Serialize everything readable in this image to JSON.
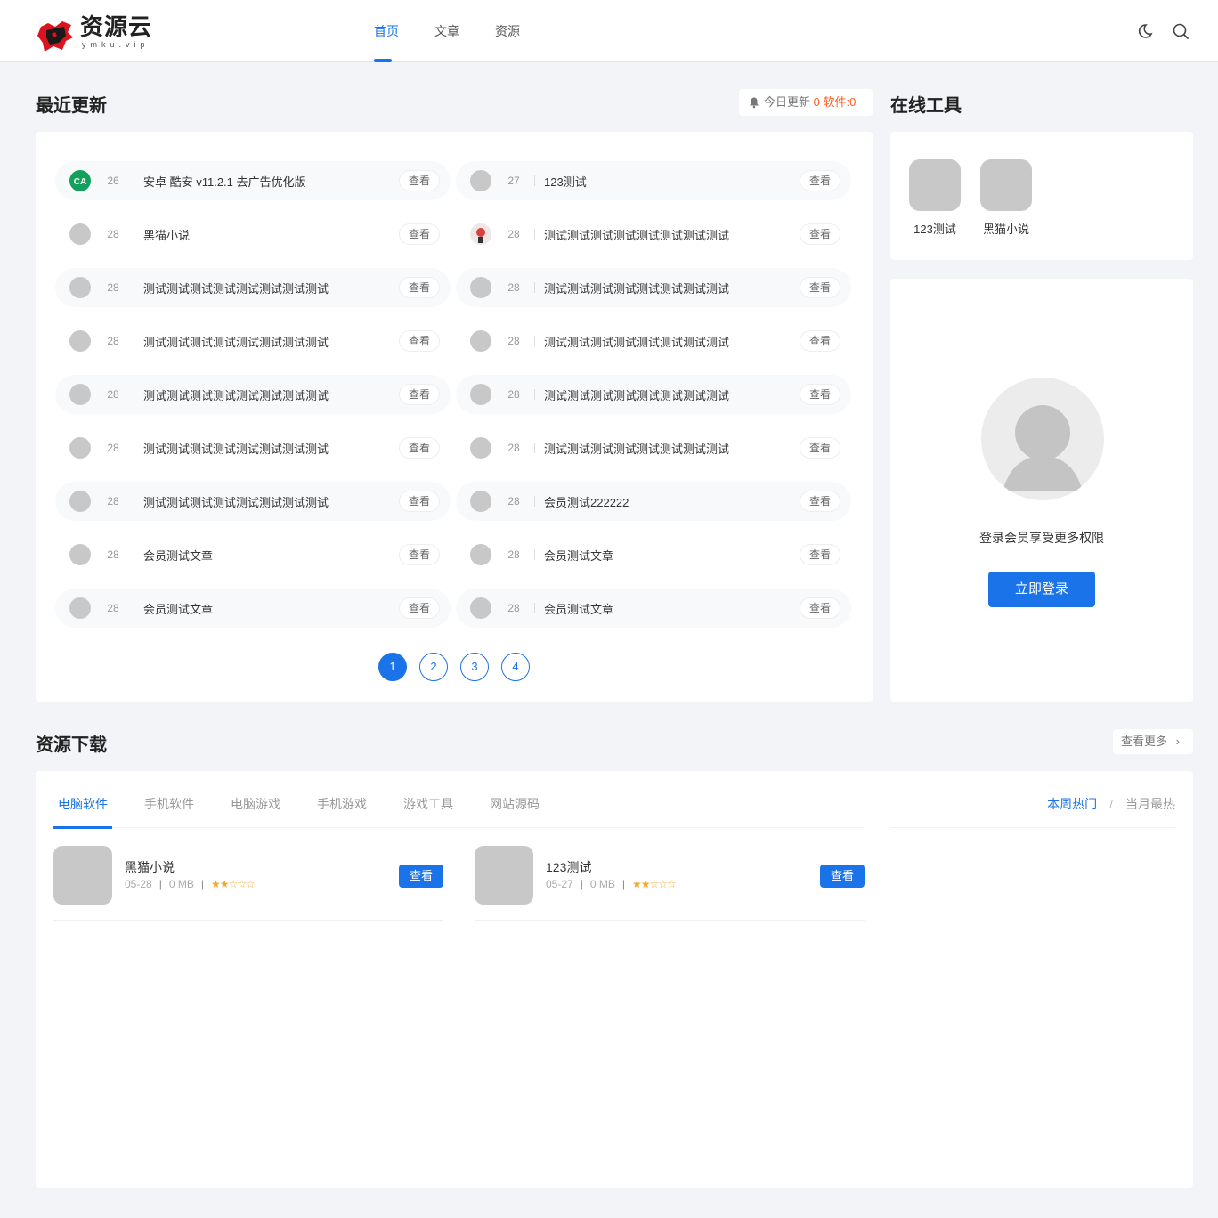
{
  "header": {
    "logo_title": "资源云",
    "logo_sub": "ymku.vip",
    "nav": [
      "首页",
      "文章",
      "资源"
    ]
  },
  "recent": {
    "title": "最近更新",
    "notice_prefix": "今日更新",
    "notice_count": "0",
    "notice_software": "软件:0",
    "view_label": "查看",
    "rows": [
      [
        {
          "num": "26",
          "title": "安卓 酷安 v11.2.1 去广告优化版"
        },
        {
          "num": "27",
          "title": "123测试"
        }
      ],
      [
        {
          "num": "28",
          "title": "黑猫小说"
        },
        {
          "num": "28",
          "title": "测试测试测试测试测试测试测试测试"
        }
      ],
      [
        {
          "num": "28",
          "title": "测试测试测试测试测试测试测试测试"
        },
        {
          "num": "28",
          "title": "测试测试测试测试测试测试测试测试"
        }
      ],
      [
        {
          "num": "28",
          "title": "测试测试测试测试测试测试测试测试"
        },
        {
          "num": "28",
          "title": "测试测试测试测试测试测试测试测试"
        }
      ],
      [
        {
          "num": "28",
          "title": "测试测试测试测试测试测试测试测试"
        },
        {
          "num": "28",
          "title": "测试测试测试测试测试测试测试测试"
        }
      ],
      [
        {
          "num": "28",
          "title": "测试测试测试测试测试测试测试测试"
        },
        {
          "num": "28",
          "title": "测试测试测试测试测试测试测试测试"
        }
      ],
      [
        {
          "num": "28",
          "title": "测试测试测试测试测试测试测试测试"
        },
        {
          "num": "28",
          "title": "会员测试222222"
        }
      ],
      [
        {
          "num": "28",
          "title": "会员测试文章"
        },
        {
          "num": "28",
          "title": "会员测试文章"
        }
      ],
      [
        {
          "num": "28",
          "title": "会员测试文章"
        },
        {
          "num": "28",
          "title": "会员测试文章"
        }
      ]
    ],
    "pages": [
      "1",
      "2",
      "3",
      "4"
    ]
  },
  "tools": {
    "title": "在线工具",
    "items": [
      "123测试",
      "黑猫小说"
    ]
  },
  "login": {
    "text": "登录会员享受更多权限",
    "button": "立即登录"
  },
  "downloads": {
    "title": "资源下载",
    "more": "查看更多",
    "tabs": [
      "电脑软件",
      "手机软件",
      "电脑游戏",
      "手机游戏",
      "游戏工具",
      "网站源码"
    ],
    "rank_tabs": [
      "本周热门",
      "当月最热"
    ],
    "items": [
      {
        "name": "黑猫小说",
        "date": "05-28",
        "size": "0 MB",
        "stars": "★★☆☆☆",
        "button": "查看"
      },
      {
        "name": "123测试",
        "date": "05-27",
        "size": "0 MB",
        "stars": "★★☆☆☆",
        "button": "查看"
      }
    ]
  },
  "colors": {
    "accent": "#1a73e8",
    "highlight": "#ff5a1f",
    "star": "#f5a623"
  }
}
